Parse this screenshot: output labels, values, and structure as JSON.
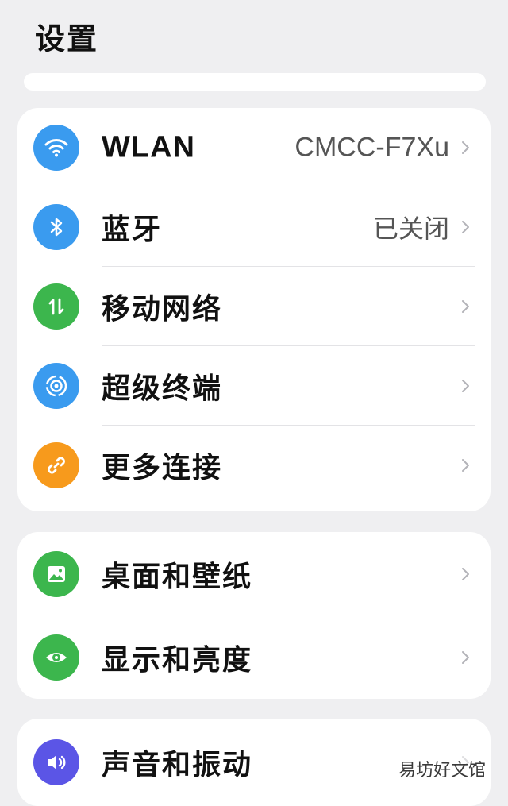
{
  "header": {
    "title": "设置"
  },
  "search": {
    "placeholder": ""
  },
  "groups": [
    {
      "items": [
        {
          "label": "WLAN",
          "value": "CMCC-F7Xu",
          "icon": "wifi-icon",
          "icon_color": "#3a9bef"
        },
        {
          "label": "蓝牙",
          "value": "已关闭",
          "icon": "bluetooth-icon",
          "icon_color": "#3a9bef"
        },
        {
          "label": "移动网络",
          "value": "",
          "icon": "mobile-data-icon",
          "icon_color": "#3cb64d"
        },
        {
          "label": "超级终端",
          "value": "",
          "icon": "super-device-icon",
          "icon_color": "#3a9bef"
        },
        {
          "label": "更多连接",
          "value": "",
          "icon": "link-icon",
          "icon_color": "#f79a1c"
        }
      ]
    },
    {
      "items": [
        {
          "label": "桌面和壁纸",
          "value": "",
          "icon": "wallpaper-icon",
          "icon_color": "#3cb64d"
        },
        {
          "label": "显示和亮度",
          "value": "",
          "icon": "eye-icon",
          "icon_color": "#3cb64d"
        }
      ]
    },
    {
      "items": [
        {
          "label": "声音和振动",
          "value": "",
          "icon": "sound-icon",
          "icon_color": "#5b55e6"
        }
      ]
    }
  ],
  "watermark": "易坊好文馆"
}
